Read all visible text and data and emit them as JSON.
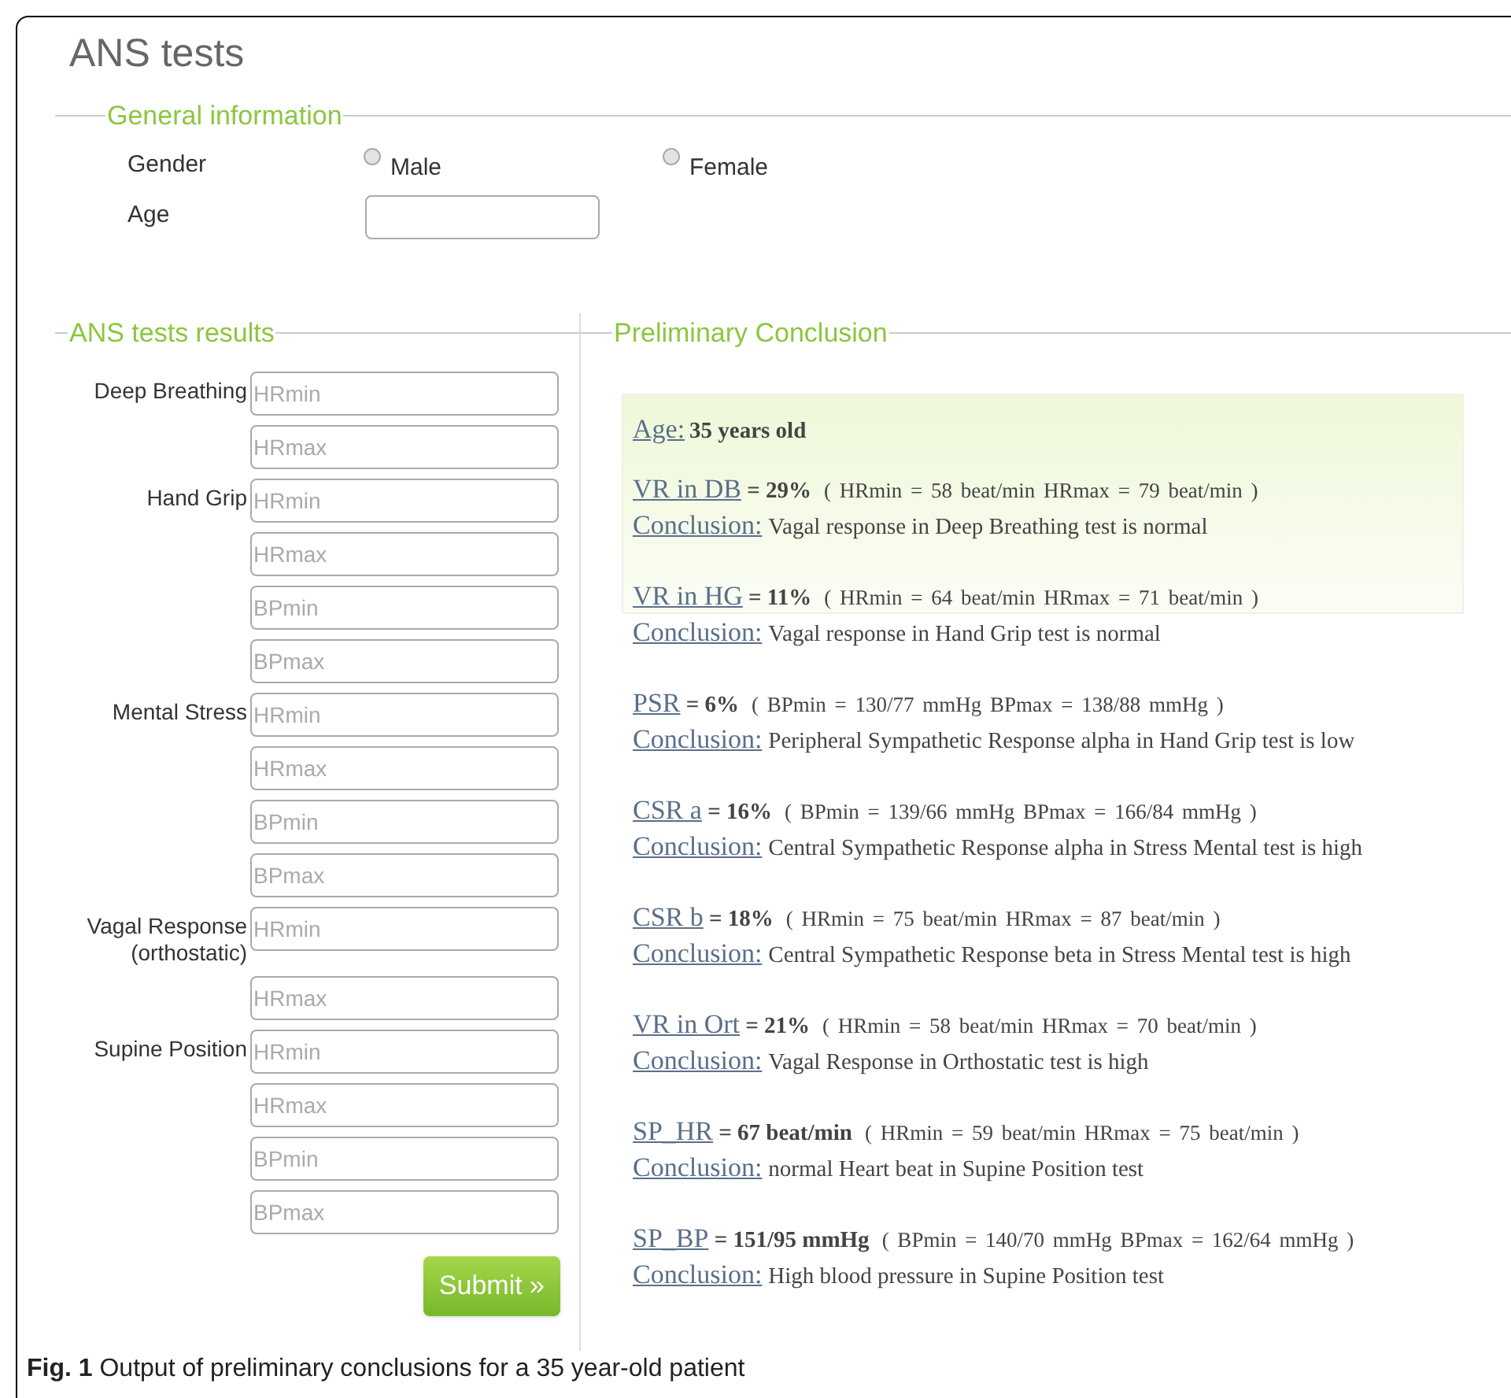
{
  "title": "ANS tests",
  "general": {
    "legend": "General information",
    "gender_label": "Gender",
    "options": [
      {
        "label": "Male",
        "selected": false
      },
      {
        "label": "Female",
        "selected": false
      }
    ],
    "age_label": "Age"
  },
  "results_form": {
    "legend": "ANS tests results",
    "groups": [
      {
        "label": "Deep Breathing",
        "fields": [
          {
            "placeholder": "HRmin"
          },
          {
            "placeholder": "HRmax"
          }
        ]
      },
      {
        "label": "Hand Grip",
        "fields": [
          {
            "placeholder": "HRmin"
          },
          {
            "placeholder": "HRmax"
          },
          {
            "placeholder": "BPmin"
          },
          {
            "placeholder": "BPmax"
          }
        ]
      },
      {
        "label": "Mental Stress",
        "fields": [
          {
            "placeholder": "HRmin"
          },
          {
            "placeholder": "HRmax"
          },
          {
            "placeholder": "BPmin"
          },
          {
            "placeholder": "BPmax"
          }
        ]
      },
      {
        "label": "Vagal Response (orthostatic)",
        "fields": [
          {
            "placeholder": "HRmin"
          },
          {
            "placeholder": "HRmax"
          }
        ]
      },
      {
        "label": "Supine Position",
        "fields": [
          {
            "placeholder": "HRmin"
          },
          {
            "placeholder": "HRmax"
          },
          {
            "placeholder": "BPmin"
          },
          {
            "placeholder": "BPmax"
          }
        ]
      }
    ],
    "submit": "Submit »"
  },
  "conclusion": {
    "legend": "Preliminary Conclusion",
    "age": {
      "label": "Age:",
      "value": "35 years old"
    },
    "results": [
      {
        "label": "VR in DB",
        "value": "= 29%",
        "detail": "( HRmin = 58 beat/min HRmax = 79 beat/min )",
        "conclusion_label": "Conclusion:",
        "conclusion": "Vagal response in Deep Breathing test is normal"
      },
      {
        "label": "VR in HG",
        "value": "= 11%",
        "detail": "( HRmin = 64 beat/min HRmax = 71 beat/min )",
        "conclusion_label": "Conclusion:",
        "conclusion": "Vagal response in Hand Grip test is normal"
      },
      {
        "label": "PSR",
        "value": "= 6%",
        "detail": "( BPmin = 130/77 mmHg BPmax = 138/88 mmHg )",
        "conclusion_label": "Conclusion:",
        "conclusion": "Peripheral Sympathetic Response alpha in Hand Grip test is low"
      },
      {
        "label": "CSR a",
        "value": "= 16%",
        "detail": "( BPmin = 139/66 mmHg BPmax = 166/84 mmHg )",
        "conclusion_label": "Conclusion:",
        "conclusion": "Central Sympathetic Response alpha in Stress Mental test is high"
      },
      {
        "label": "CSR b",
        "value": "= 18%",
        "detail": "( HRmin = 75 beat/min HRmax = 87 beat/min )",
        "conclusion_label": "Conclusion:",
        "conclusion": "Central Sympathetic Response beta in Stress Mental test is high"
      },
      {
        "label": "VR in Ort",
        "value": "= 21%",
        "detail": "( HRmin = 58 beat/min HRmax = 70 beat/min )",
        "conclusion_label": "Conclusion:",
        "conclusion": "Vagal Response in Orthostatic test is high"
      },
      {
        "label": "SP_HR",
        "value": "= 67 beat/min",
        "detail": "( HRmin = 59 beat/min HRmax = 75 beat/min )",
        "conclusion_label": "Conclusion:",
        "conclusion": "normal Heart beat in Supine Position test"
      },
      {
        "label": "SP_BP",
        "value": "= 151/95 mmHg",
        "detail": "( BPmin = 140/70 mmHg BPmax = 162/64 mmHg )",
        "conclusion_label": "Conclusion:",
        "conclusion": "High blood pressure in Supine Position test"
      }
    ]
  },
  "caption": "**Fig. 1** Output of preliminary conclusions for a 35 year-old patient"
}
